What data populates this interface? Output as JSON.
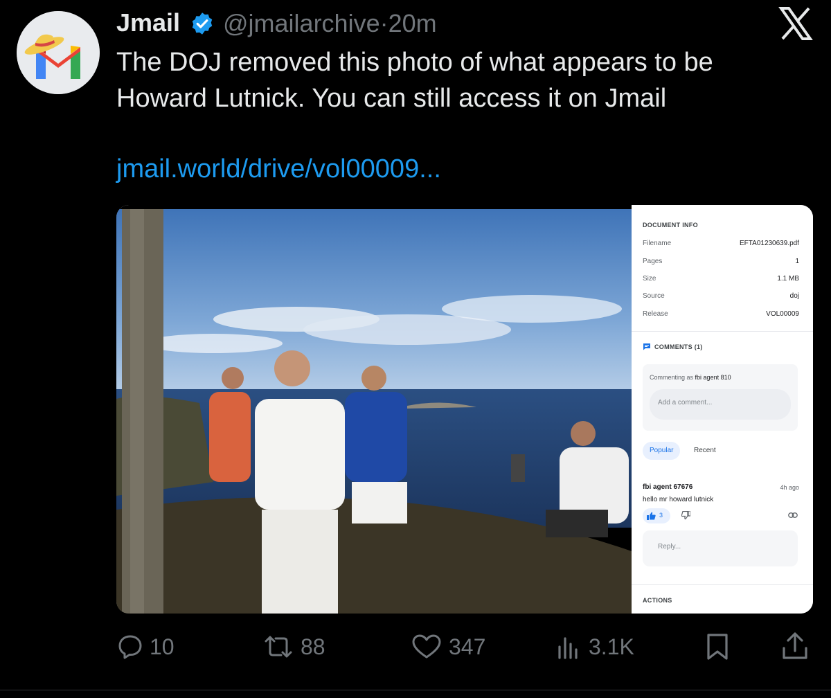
{
  "tweet": {
    "author_name": "Jmail",
    "handle": "@jmailarchive",
    "separator": "·",
    "time": "20m",
    "text": "The DOJ removed this photo of what appears to be\nHoward Lutnick. You can still access it on Jmail",
    "link": "jmail.world/drive/vol00009...",
    "avatar_icon": "gmail-logo-with-straw-hat",
    "platform_icon": "x-logo-icon"
  },
  "panel": {
    "doc_info_heading": "DOCUMENT INFO",
    "doc_info": [
      {
        "label": "Filename",
        "value": "EFTA01230639.pdf"
      },
      {
        "label": "Pages",
        "value": "1"
      },
      {
        "label": "Size",
        "value": "1.1 MB"
      },
      {
        "label": "Source",
        "value": "doj"
      },
      {
        "label": "Release",
        "value": "VOL00009"
      }
    ],
    "comments_heading": "COMMENTS (1)",
    "commenting_as_prefix": "Commenting as",
    "commenting_as_user": "fbi agent 810",
    "add_comment_placeholder": "Add a comment...",
    "tabs": {
      "popular": "Popular",
      "recent": "Recent"
    },
    "comment": {
      "author": "fbi agent 67676",
      "time": "4h ago",
      "text": "hello mr howard lutnick",
      "likes": "3"
    },
    "reply_placeholder": "Reply...",
    "actions_heading": "ACTIONS"
  },
  "actions": {
    "replies": "10",
    "reposts": "88",
    "likes": "347",
    "views": "3.1K"
  },
  "colors": {
    "background": "#000000",
    "text": "#e7e9ea",
    "muted": "#71767b",
    "link": "#1d9bf0",
    "panel_accent": "#1a73e8"
  }
}
